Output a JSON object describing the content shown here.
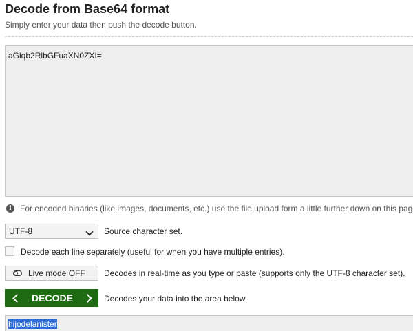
{
  "header": {
    "title": "Decode from Base64 format",
    "subtitle": "Simply enter your data then push the decode button."
  },
  "input": {
    "value": "aGlqb2RlbGFuaXN0ZXI="
  },
  "info": {
    "icon": "info-icon",
    "text": "For encoded binaries (like images, documents, etc.) use the file upload form a little further down on this page."
  },
  "charset": {
    "selected": "UTF-8",
    "label": "Source character set."
  },
  "line_mode": {
    "checked": false,
    "label": "Decode each line separately (useful for when you have multiple entries)."
  },
  "live_mode": {
    "button_label": "Live mode OFF",
    "description": "Decodes in real-time as you type or paste (supports only the UTF-8 character set)."
  },
  "decode": {
    "button_label": "DECODE",
    "description": "Decodes your data into the area below.",
    "color": "#1e6b11"
  },
  "output": {
    "value": "hijodelanister",
    "selected": true
  }
}
